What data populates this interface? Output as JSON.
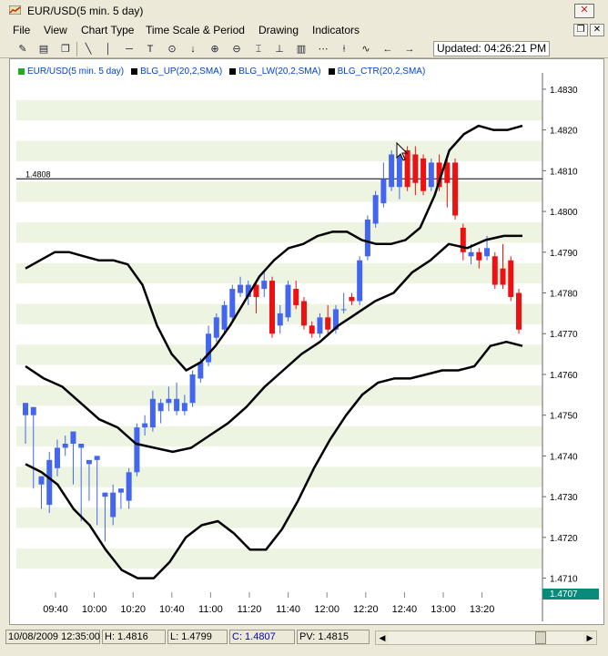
{
  "window": {
    "title": "EUR/USD(5 min.  5 day)",
    "close_label": "✕",
    "mdi_restore_label": "❐",
    "mdi_close_label": "✕"
  },
  "menu": [
    "File",
    "View",
    "Chart Type",
    "Time Scale & Period",
    "Drawing",
    "Indicators"
  ],
  "toolbar": {
    "icons": [
      "draw-tool-icon",
      "print-icon",
      "copy-icon",
      "line-tool-icon",
      "vertical-line-icon",
      "horizontal-line-icon",
      "text-tool-icon",
      "target-icon",
      "down-arrow-icon",
      "zoom-in-icon",
      "zoom-out-icon",
      "fit-icon",
      "baseline-icon",
      "bar-chart-icon",
      "indicator-icon",
      "scroll-left-icon",
      "scroll-right-icon"
    ],
    "updated": "Updated: 04:26:21 PM"
  },
  "legend": [
    {
      "label": "EUR/USD(5 min. 5 day)",
      "color": "#22aa22"
    },
    {
      "label": "BLG_UP(20,2,SMA)",
      "color": "#000000"
    },
    {
      "label": "BLG_LW(20,2,SMA)",
      "color": "#000000"
    },
    {
      "label": "BLG_CTR(20,2,SMA)",
      "color": "#000000"
    }
  ],
  "chart_data": {
    "type": "candlestick",
    "y_ticks": [
      "1.4830",
      "1.4820",
      "1.4810",
      "1.4800",
      "1.4790",
      "1.4780",
      "1.4770",
      "1.4760",
      "1.4750",
      "1.4740",
      "1.4730",
      "1.4720",
      "1.4710"
    ],
    "x_ticks": [
      "09:40",
      "10:00",
      "10:20",
      "10:40",
      "11:00",
      "11:20",
      "11:40",
      "12:00",
      "12:20",
      "12:40",
      "13:00",
      "13:20"
    ],
    "ylim": [
      1.4707,
      1.4834
    ],
    "hline_label": "1.4808",
    "hline_value": 1.4808,
    "last_price_label": "1.4707",
    "up_color": "#4466ee",
    "down_color": "#ee1111",
    "candles": [
      [
        1.475,
        1.4753,
        1.4745,
        1.4743
      ],
      [
        1.475,
        1.4752,
        1.4733,
        1.4732
      ],
      [
        1.4733,
        1.4735,
        1.4728,
        1.4727
      ],
      [
        1.4728,
        1.4739,
        1.4741,
        1.4726
      ],
      [
        1.4737,
        1.4742,
        1.4744,
        1.4735
      ],
      [
        1.4742,
        1.4743,
        1.4745,
        1.474
      ],
      [
        1.4743,
        1.4746,
        1.474,
        1.4733
      ],
      [
        1.4742,
        1.4743,
        1.473,
        1.4724
      ],
      [
        1.4738,
        1.4739,
        1.473,
        1.4729
      ],
      [
        1.4739,
        1.474,
        1.4726,
        1.4723
      ],
      [
        1.473,
        1.4731,
        1.4722,
        1.4719
      ],
      [
        1.4725,
        1.4731,
        1.4733,
        1.4723
      ],
      [
        1.4731,
        1.4732,
        1.4729,
        1.4727
      ],
      [
        1.4729,
        1.4736,
        1.4737,
        1.4727
      ],
      [
        1.4736,
        1.4747,
        1.4748,
        1.4735
      ],
      [
        1.4747,
        1.4748,
        1.475,
        1.4745
      ],
      [
        1.4747,
        1.4754,
        1.4756,
        1.4746
      ],
      [
        1.4751,
        1.4753,
        1.4754,
        1.4748
      ],
      [
        1.4753,
        1.4754,
        1.4757,
        1.4751
      ],
      [
        1.4751,
        1.4754,
        1.4758,
        1.475
      ],
      [
        1.4751,
        1.4753,
        1.4755,
        1.475
      ],
      [
        1.4753,
        1.476,
        1.4761,
        1.4752
      ],
      [
        1.4759,
        1.4763,
        1.4764,
        1.4758
      ],
      [
        1.4763,
        1.477,
        1.4772,
        1.4762
      ],
      [
        1.4769,
        1.4774,
        1.4775,
        1.4768
      ],
      [
        1.4771,
        1.4777,
        1.4778,
        1.477
      ],
      [
        1.4774,
        1.4781,
        1.4782,
        1.4773
      ],
      [
        1.478,
        1.4782,
        1.4784,
        1.4779
      ],
      [
        1.4779,
        1.4782,
        1.4783,
        1.4777
      ],
      [
        1.4782,
        1.4779,
        1.4783,
        1.4775
      ],
      [
        1.4781,
        1.4783,
        1.4785,
        1.4779
      ],
      [
        1.4783,
        1.477,
        1.4784,
        1.4769
      ],
      [
        1.4772,
        1.4775,
        1.4777,
        1.477
      ],
      [
        1.4774,
        1.4782,
        1.4783,
        1.4773
      ],
      [
        1.4781,
        1.4777,
        1.4783,
        1.4776
      ],
      [
        1.4778,
        1.4772,
        1.4779,
        1.4771
      ],
      [
        1.4772,
        1.477,
        1.4773,
        1.4769
      ],
      [
        1.477,
        1.4774,
        1.4775,
        1.4769
      ],
      [
        1.4774,
        1.4771,
        1.4777,
        1.477
      ],
      [
        1.4771,
        1.4776,
        1.4777,
        1.477
      ],
      [
        1.4776,
        1.4776,
        1.478,
        1.4775
      ],
      [
        1.4779,
        1.4778,
        1.478,
        1.4777
      ],
      [
        1.4778,
        1.4788,
        1.4789,
        1.4777
      ],
      [
        1.4789,
        1.4798,
        1.4799,
        1.4788
      ],
      [
        1.4797,
        1.4804,
        1.4805,
        1.4796
      ],
      [
        1.4802,
        1.4808,
        1.4812,
        1.4801
      ],
      [
        1.4806,
        1.4814,
        1.4815,
        1.4805
      ],
      [
        1.4806,
        1.4815,
        1.4816,
        1.4803
      ],
      [
        1.4815,
        1.4806,
        1.4816,
        1.4805
      ],
      [
        1.4814,
        1.4807,
        1.4816,
        1.4804
      ],
      [
        1.4813,
        1.4805,
        1.4814,
        1.4804
      ],
      [
        1.4806,
        1.4812,
        1.4813,
        1.4805
      ],
      [
        1.4812,
        1.4806,
        1.4814,
        1.4805
      ],
      [
        1.4812,
        1.4807,
        1.4813,
        1.4801
      ],
      [
        1.4812,
        1.4799,
        1.4813,
        1.4798
      ],
      [
        1.4796,
        1.479,
        1.4797,
        1.4788
      ],
      [
        1.4789,
        1.479,
        1.4792,
        1.4787
      ],
      [
        1.479,
        1.4788,
        1.4791,
        1.4786
      ],
      [
        1.4789,
        1.4791,
        1.4794,
        1.4788
      ],
      [
        1.4789,
        1.4782,
        1.479,
        1.4781
      ],
      [
        1.4786,
        1.4782,
        1.4792,
        1.4781
      ],
      [
        1.4788,
        1.4779,
        1.4789,
        1.4778
      ],
      [
        1.478,
        1.4771,
        1.4781,
        1.477
      ]
    ],
    "bollinger_up": [
      1.4786,
      1.4788,
      1.479,
      1.479,
      1.4789,
      1.4788,
      1.4788,
      1.4787,
      1.4782,
      1.4772,
      1.4765,
      1.4761,
      1.4763,
      1.4767,
      1.4772,
      1.4778,
      1.4784,
      1.4788,
      1.4791,
      1.4792,
      1.4794,
      1.4795,
      1.4795,
      1.4793,
      1.4792,
      1.4792,
      1.4793,
      1.4796,
      1.4804,
      1.4815,
      1.4819,
      1.4821,
      1.482,
      1.482,
      1.4821
    ],
    "bollinger_ctr": [
      1.4762,
      1.4759,
      1.4757,
      1.4753,
      1.4749,
      1.4747,
      1.4743,
      1.4742,
      1.4741,
      1.4742,
      1.4745,
      1.4748,
      1.4752,
      1.4757,
      1.4761,
      1.4765,
      1.4768,
      1.4772,
      1.4775,
      1.4778,
      1.478,
      1.4785,
      1.4788,
      1.4792,
      1.4791,
      1.4793,
      1.4794,
      1.4794
    ],
    "bollinger_lw": [
      1.4738,
      1.4736,
      1.4733,
      1.4727,
      1.4723,
      1.4717,
      1.4712,
      1.471,
      1.471,
      1.4714,
      1.472,
      1.4723,
      1.4724,
      1.4721,
      1.4717,
      1.4717,
      1.4722,
      1.4729,
      1.4737,
      1.4744,
      1.475,
      1.4755,
      1.4758,
      1.4759,
      1.4759,
      1.476,
      1.4761,
      1.4761,
      1.4762,
      1.4767,
      1.4768,
      1.4767
    ]
  },
  "status": {
    "datetime": "10/08/2009 12:35:00",
    "high": "H: 1.4816",
    "low": "L: 1.4799",
    "close": "C: 1.4807",
    "pv": "PV: 1.4815"
  }
}
